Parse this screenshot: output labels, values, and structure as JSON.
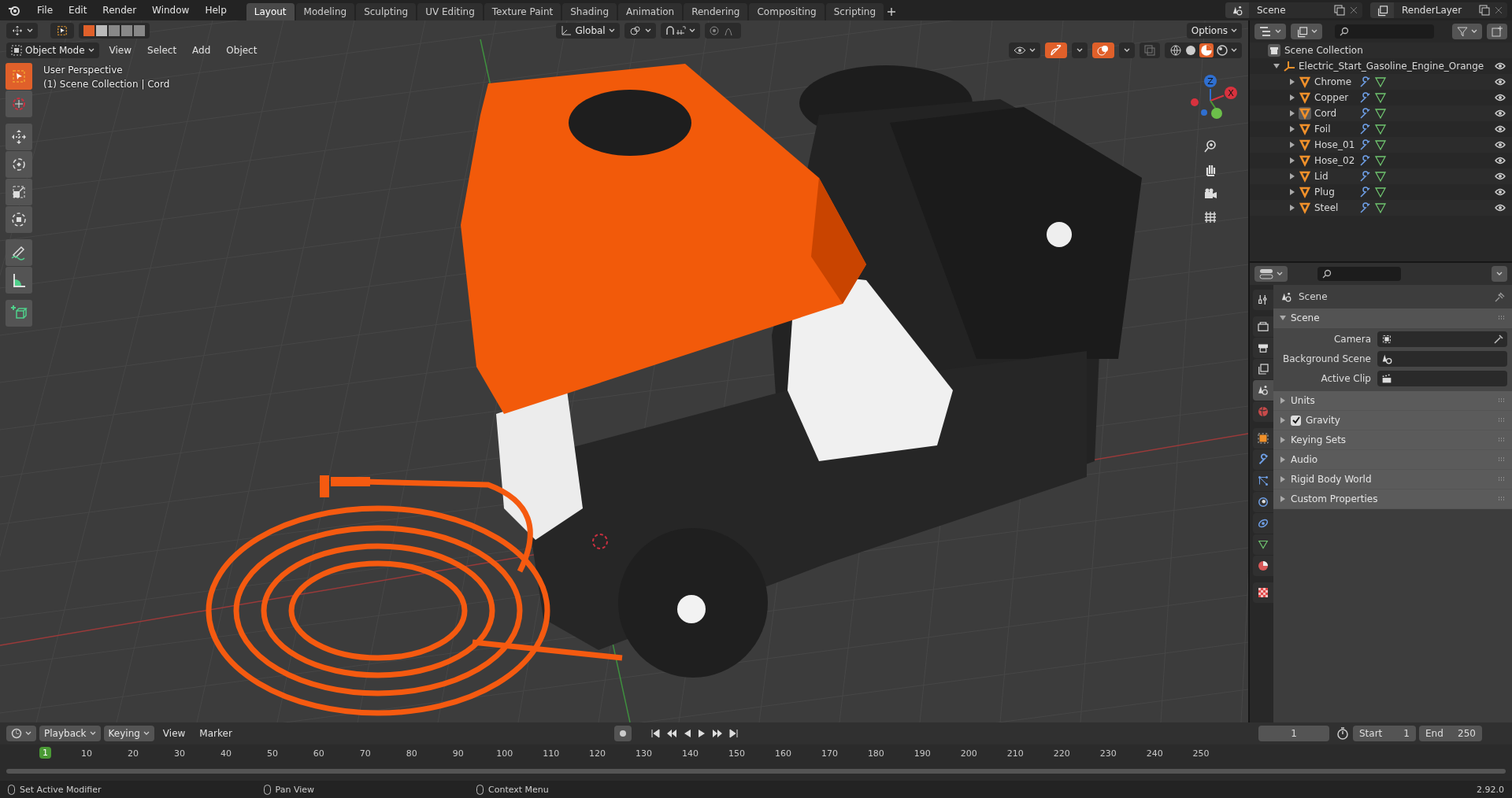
{
  "menus": [
    "File",
    "Edit",
    "Render",
    "Window",
    "Help"
  ],
  "workspaces": [
    {
      "label": "Layout",
      "selected": true
    },
    {
      "label": "Modeling",
      "selected": false
    },
    {
      "label": "Sculpting",
      "selected": false
    },
    {
      "label": "UV Editing",
      "selected": false
    },
    {
      "label": "Texture Paint",
      "selected": false
    },
    {
      "label": "Shading",
      "selected": false
    },
    {
      "label": "Animation",
      "selected": false
    },
    {
      "label": "Rendering",
      "selected": false
    },
    {
      "label": "Compositing",
      "selected": false
    },
    {
      "label": "Scripting",
      "selected": false
    }
  ],
  "scene": "Scene",
  "view_layer": "RenderLayer",
  "viewport": {
    "orientation": "Global",
    "options": "Options",
    "mode": "Object Mode",
    "menus": [
      "View",
      "Select",
      "Add",
      "Object"
    ],
    "view_name": "User Perspective",
    "context": "(1) Scene Collection | Cord",
    "tool_groups": [
      [
        {
          "kind": "select",
          "selected": true
        },
        {
          "kind": "cursor",
          "selected": false
        }
      ],
      [
        {
          "kind": "move",
          "selected": false
        },
        {
          "kind": "rotate",
          "selected": false
        },
        {
          "kind": "scale",
          "selected": false
        },
        {
          "kind": "transform",
          "selected": false
        }
      ],
      [
        {
          "kind": "annotate",
          "selected": false
        },
        {
          "kind": "measure",
          "selected": false
        }
      ],
      [
        {
          "kind": "add_cube",
          "selected": false
        }
      ]
    ],
    "axes": [
      {
        "label": "Z",
        "color": "#2f6fd0"
      },
      {
        "label": "X",
        "color": "#d8323e"
      }
    ]
  },
  "outliner": {
    "root": "Scene Collection",
    "collection": {
      "name": "Electric_Start_Gasoline_Engine_Orange",
      "expanded": true,
      "children": [
        {
          "name": "Chrome",
          "active": false
        },
        {
          "name": "Copper",
          "active": false
        },
        {
          "name": "Cord",
          "active": true
        },
        {
          "name": "Foil",
          "active": false
        },
        {
          "name": "Hose_01",
          "active": false
        },
        {
          "name": "Hose_02",
          "active": false
        },
        {
          "name": "Lid",
          "active": false
        },
        {
          "name": "Plug",
          "active": false
        },
        {
          "name": "Steel",
          "active": false
        }
      ]
    }
  },
  "properties": {
    "context": "Scene",
    "tab_groups": [
      [
        {
          "kind": "tool",
          "selected": false
        }
      ],
      [
        {
          "kind": "render",
          "selected": false
        },
        {
          "kind": "output",
          "selected": false
        },
        {
          "kind": "view_layer",
          "selected": false
        },
        {
          "kind": "scene",
          "selected": true
        },
        {
          "kind": "world",
          "selected": false
        }
      ],
      [
        {
          "kind": "object",
          "selected": false
        },
        {
          "kind": "modifiers",
          "selected": false
        },
        {
          "kind": "particles",
          "selected": false
        },
        {
          "kind": "physics",
          "selected": false
        },
        {
          "kind": "constraints",
          "selected": false
        },
        {
          "kind": "data",
          "selected": false
        },
        {
          "kind": "material",
          "selected": false
        }
      ],
      [
        {
          "kind": "texture",
          "selected": false
        }
      ]
    ],
    "panels": [
      {
        "title": "Scene",
        "expanded": true,
        "fields": [
          {
            "label": "Camera",
            "kind": "camera"
          },
          {
            "label": "Background Scene",
            "kind": "scene"
          },
          {
            "label": "Active Clip",
            "kind": "clip"
          }
        ]
      },
      {
        "title": "Units",
        "expanded": false
      },
      {
        "title": "Gravity",
        "expanded": false,
        "checked": true
      },
      {
        "title": "Keying Sets",
        "expanded": false
      },
      {
        "title": "Audio",
        "expanded": false
      },
      {
        "title": "Rigid Body World",
        "expanded": false
      },
      {
        "title": "Custom Properties",
        "expanded": false
      }
    ]
  },
  "timeline": {
    "menus": [
      "Playback",
      "Keying",
      "View",
      "Marker"
    ],
    "current_frame": "1",
    "start_label": "Start",
    "start": "1",
    "end_label": "End",
    "end": "250",
    "playhead": "1",
    "ticks": [
      "10",
      "20",
      "30",
      "40",
      "50",
      "60",
      "70",
      "80",
      "90",
      "100",
      "110",
      "120",
      "130",
      "140",
      "150",
      "160",
      "170",
      "180",
      "190",
      "200",
      "210",
      "220",
      "230",
      "240",
      "250"
    ]
  },
  "status_bar": {
    "hints": [
      "Set Active Modifier",
      "Pan View",
      "Context Menu"
    ],
    "version": "2.92.0"
  }
}
